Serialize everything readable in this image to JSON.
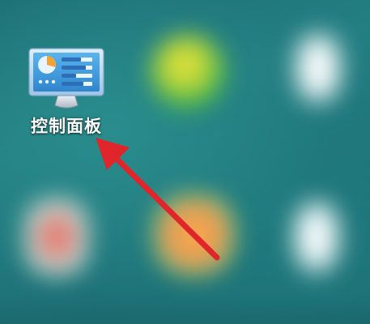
{
  "desktop": {
    "icons": [
      {
        "label": "控制面板",
        "icon": "control-panel-icon"
      }
    ],
    "annotation": {
      "type": "arrow",
      "color": "#e0262b"
    }
  }
}
